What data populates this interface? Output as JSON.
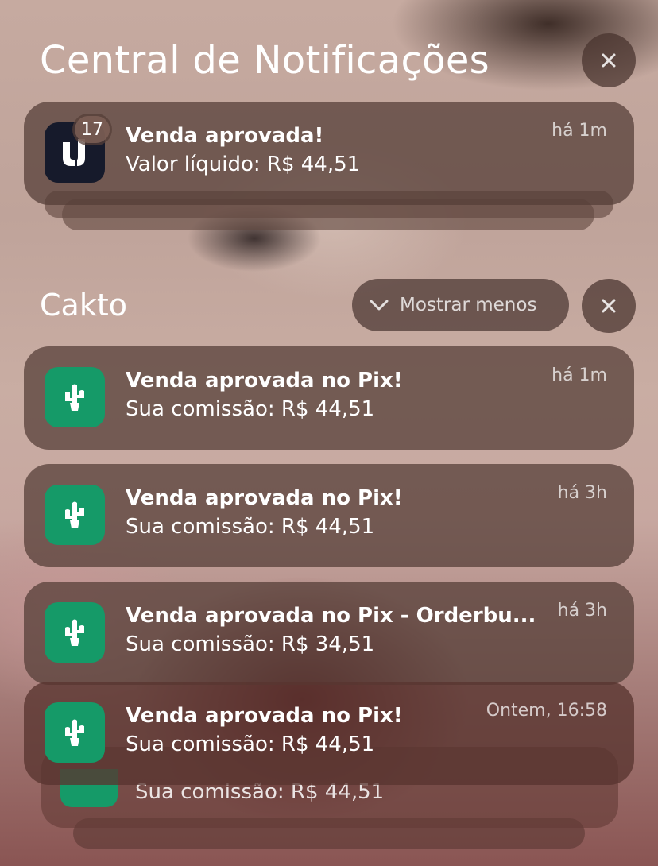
{
  "header": {
    "title": "Central de Notificações",
    "close_icon": "close-icon"
  },
  "top_group": {
    "badge_count": "17",
    "app_icon": "u-logo-icon",
    "notification": {
      "title": "Venda aprovada!",
      "body": "Valor líquido: R$ 44,51",
      "time": "há 1m"
    }
  },
  "cakto_group": {
    "title": "Cakto",
    "show_less_label": "Mostrar menos",
    "app_icon": "cactus-icon",
    "accent": "#159a68",
    "notifications": [
      {
        "title": "Venda aprovada no Pix!",
        "body": "Sua comissão: R$ 44,51",
        "time": "há 1m"
      },
      {
        "title": "Venda aprovada no Pix!",
        "body": "Sua comissão: R$ 44,51",
        "time": "há 3h"
      },
      {
        "title": "Venda aprovada no Pix - Orderbu...",
        "body": "Sua comissão: R$ 34,51",
        "time": "há 3h"
      },
      {
        "title": "Venda aprovada no Pix!",
        "body": "Sua comissão: R$ 44,51",
        "time": "Ontem, 16:58"
      }
    ],
    "stacked_behind": {
      "body": "Sua comissão: R$ 44,51"
    }
  }
}
